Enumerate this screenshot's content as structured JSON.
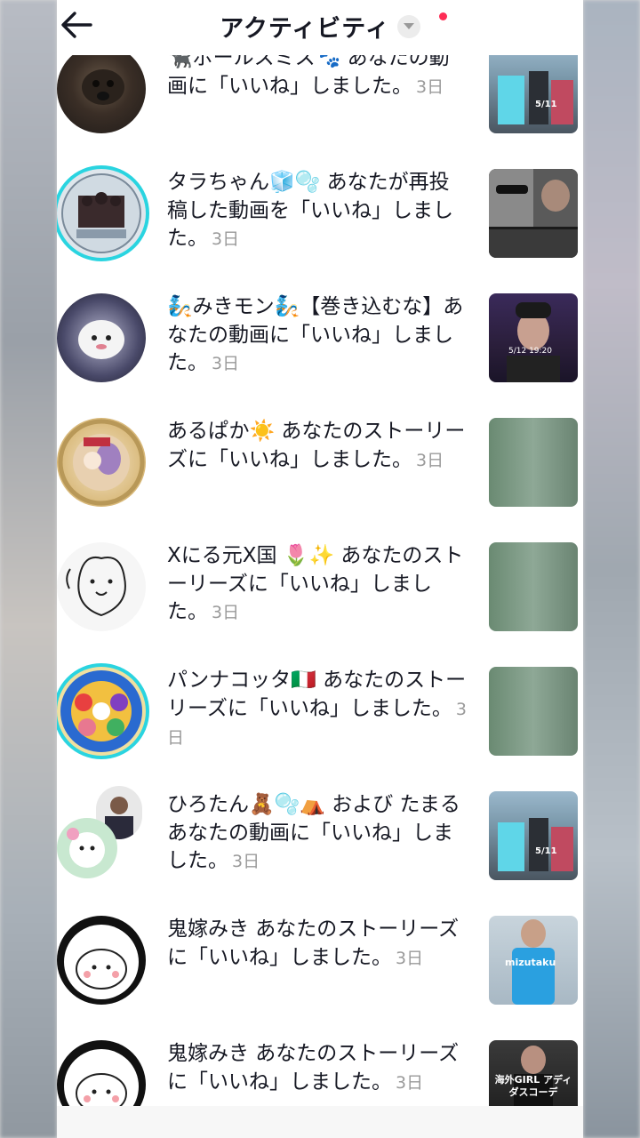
{
  "header": {
    "title": "アクティビティ"
  },
  "items": [
    {
      "text": "🐈‍⬛ポールスミス🐾 あなたの動画に「いいね」しました。",
      "time": "3日",
      "avatar": "dog-photo",
      "thumb": "street-video"
    },
    {
      "text": "タラちゃん🧊🫧 あなたが再投稿した動画を「いいね」しました。",
      "time": "3日",
      "avatar": "framed-logo",
      "thumb": "selfie-collage"
    },
    {
      "text": "🧞みきモン🧞【巻き込むな】あなたの動画に「いいね」しました。",
      "time": "3日",
      "avatar": "illustrated-character",
      "thumb": "live-stream"
    },
    {
      "text": "あるぱか☀️ あなたのストーリーズに「いいね」しました。",
      "time": "3日",
      "avatar": "character-circle",
      "thumb": "green-gradient"
    },
    {
      "text": "Xにる元X国 🌷✨ あなたのストーリーズに「いいね」しました。",
      "time": "3日",
      "avatar": "sketch-dog",
      "thumb": "green-gradient"
    },
    {
      "text": "パンナコッタ🇮🇹 あなたのストーリーズに「いいね」しました。",
      "time": "3日",
      "avatar": "flower-art",
      "thumb": "green-gradient"
    },
    {
      "text": "ひろたん🧸🫧⛺ および たまる あなたの動画に「いいね」しました。",
      "time": "3日",
      "avatar": "double-avatar",
      "thumb": "street-video"
    },
    {
      "text": "鬼嫁みき あなたのストーリーズに「いいね」しました。",
      "time": "3日",
      "avatar": "cat-cartoon",
      "thumb": "runner-photo"
    },
    {
      "text": "鬼嫁みき あなたのストーリーズに「いいね」しました。",
      "time": "3日",
      "avatar": "cat-cartoon",
      "thumb": "fashion-photo"
    }
  ],
  "thumb_labels": {
    "t0": "5/11",
    "t2": "5/12 19:20",
    "t7": "mizutaku",
    "t8": "海外GIRL アディダスコーデ"
  },
  "colors": {
    "accent": "#fe2c55",
    "ring": "#2ad4e0",
    "text": "#161823",
    "muted": "#9a9a9a"
  }
}
